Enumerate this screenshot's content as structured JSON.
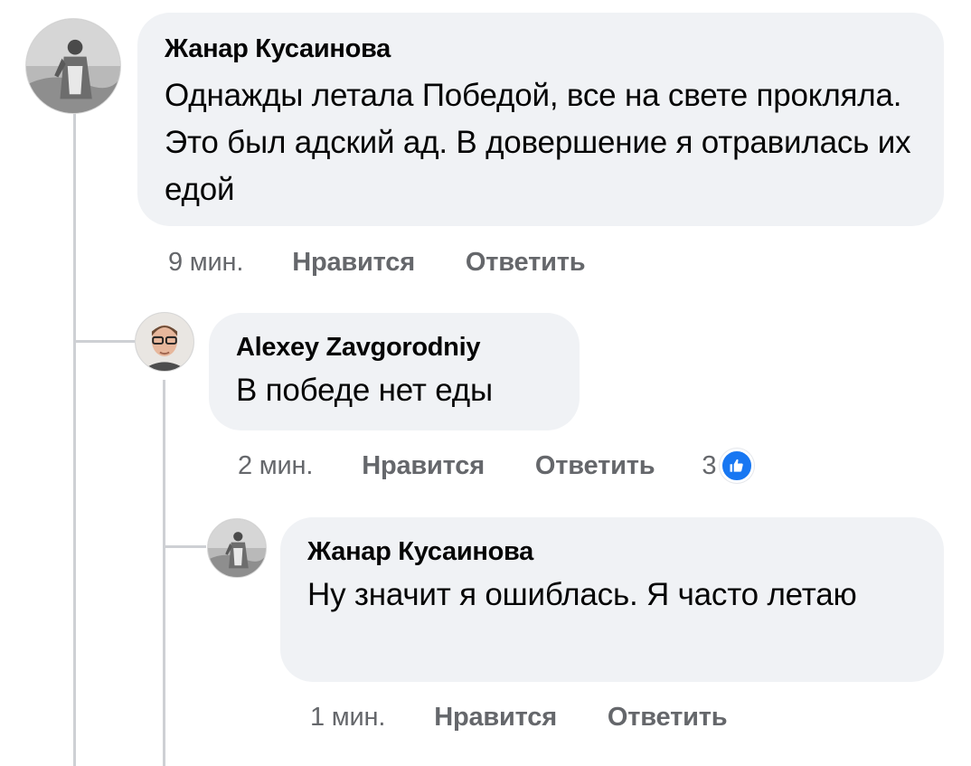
{
  "colors": {
    "bubble_bg": "#f0f2f5",
    "meta_text": "#65676b",
    "body_text": "#050505",
    "thread_line": "#ced0d4",
    "like_blue": "#1877f2"
  },
  "comments": [
    {
      "author": "Жанар Кусаинова",
      "text": "Однажды летала Победой, все на свете прокляла. Это был адский ад. В довершение я отравилась их едой",
      "time": "9 мин.",
      "like_label": "Нравится",
      "reply_label": "Ответить"
    },
    {
      "author": "Alexey Zavgorodniy",
      "text": "В победе нет еды",
      "time": "2 мин.",
      "like_label": "Нравится",
      "reply_label": "Ответить",
      "reaction_count": "3",
      "reaction_icon": "thumbs-up-icon"
    },
    {
      "author": "Жанар Кусаинова",
      "text": "Ну значит я ошиблась. Я часто летаю",
      "time": "1 мин.",
      "like_label": "Нравится",
      "reply_label": "Ответить"
    }
  ]
}
